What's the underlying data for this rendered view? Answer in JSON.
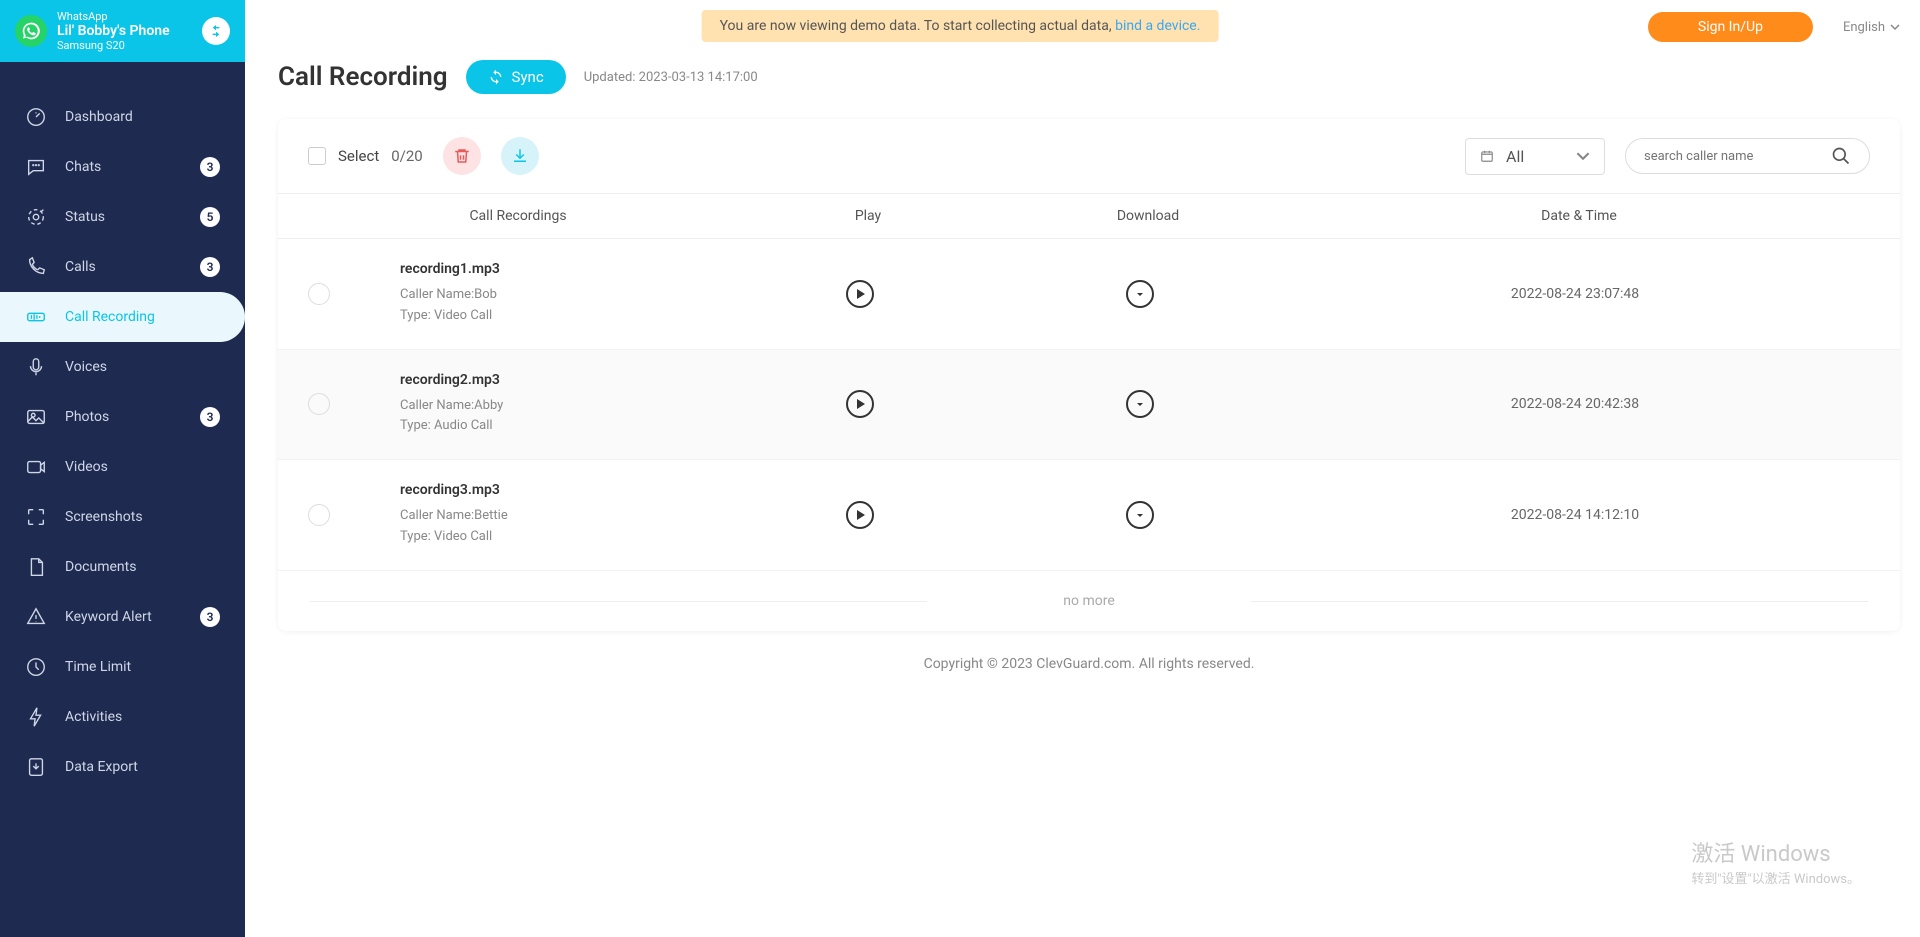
{
  "header": {
    "appName": "WhatsApp",
    "phoneName": "Lil' Bobby's Phone",
    "deviceModel": "Samsung S20"
  },
  "nav": [
    {
      "id": "dashboard",
      "label": "Dashboard",
      "badge": null
    },
    {
      "id": "chats",
      "label": "Chats",
      "badge": "3"
    },
    {
      "id": "status",
      "label": "Status",
      "badge": "5"
    },
    {
      "id": "calls",
      "label": "Calls",
      "badge": "3"
    },
    {
      "id": "call-recording",
      "label": "Call Recording",
      "badge": null,
      "active": true
    },
    {
      "id": "voices",
      "label": "Voices",
      "badge": null
    },
    {
      "id": "photos",
      "label": "Photos",
      "badge": "3"
    },
    {
      "id": "videos",
      "label": "Videos",
      "badge": null
    },
    {
      "id": "screenshots",
      "label": "Screenshots",
      "badge": null
    },
    {
      "id": "documents",
      "label": "Documents",
      "badge": null
    },
    {
      "id": "keyword-alert",
      "label": "Keyword Alert",
      "badge": "3"
    },
    {
      "id": "time-limit",
      "label": "Time Limit",
      "badge": null
    },
    {
      "id": "activities",
      "label": "Activities",
      "badge": null
    },
    {
      "id": "data-export",
      "label": "Data Export",
      "badge": null
    }
  ],
  "banner": {
    "text": "You are now viewing demo data. To start collecting actual data, ",
    "link": "bind a device."
  },
  "topRight": {
    "signIn": "Sign In/Up",
    "language": "English"
  },
  "page": {
    "title": "Call Recording",
    "syncLabel": "Sync",
    "updated": "Updated: 2023-03-13 14:17:00"
  },
  "toolbar": {
    "selectLabel": "Select",
    "selectCount": "0/20",
    "filterValue": "All",
    "searchPlaceholder": "search caller name"
  },
  "columns": {
    "rec": "Call Recordings",
    "play": "Play",
    "dl": "Download",
    "date": "Date & Time"
  },
  "rows": [
    {
      "name": "recording1.mp3",
      "caller": "Caller Name:Bob",
      "type": "Type: Video Call",
      "date": "2022-08-24 23:07:48"
    },
    {
      "name": "recording2.mp3",
      "caller": "Caller Name:Abby",
      "type": "Type: Audio Call",
      "date": "2022-08-24 20:42:38"
    },
    {
      "name": "recording3.mp3",
      "caller": "Caller Name:Bettie",
      "type": "Type: Video Call",
      "date": "2022-08-24 14:12:10"
    }
  ],
  "noMore": "no more",
  "footer": "Copyright © 2023 ClevGuard.com. All rights reserved.",
  "watermark": {
    "line1": "激活 Windows",
    "line2": "转到\"设置\"以激活 Windows。"
  }
}
